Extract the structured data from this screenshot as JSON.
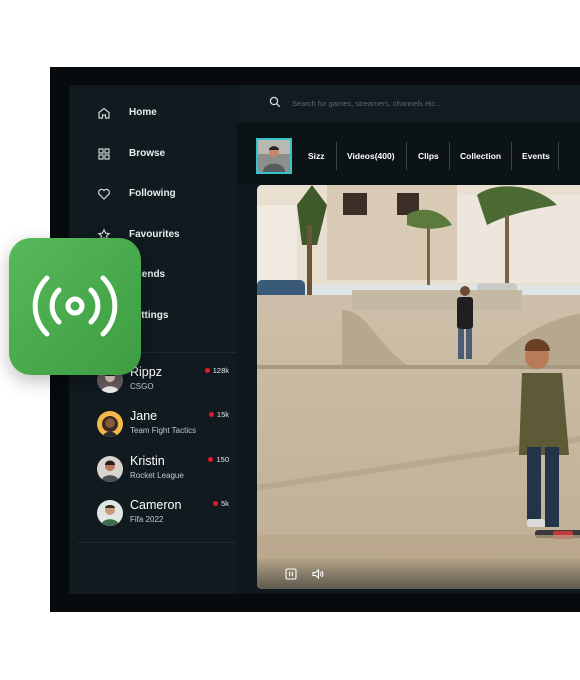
{
  "search": {
    "placeholder": "Search for games, streamers, channels etc..."
  },
  "nav": [
    {
      "label": "Home",
      "icon": "home-icon"
    },
    {
      "label": "Browse",
      "icon": "grid-icon"
    },
    {
      "label": "Following",
      "icon": "heart-icon"
    },
    {
      "label": "Favourites",
      "icon": "star-icon"
    },
    {
      "label": "Friends",
      "icon": "friends-icon"
    },
    {
      "label": "Settings",
      "icon": "gear-icon"
    }
  ],
  "streams": [
    {
      "name": "Rippz",
      "game": "CSGO",
      "views": "128k"
    },
    {
      "name": "Jane",
      "game": "Team Fight Tactics",
      "views": "15k"
    },
    {
      "name": "Kristin",
      "game": "Rocket League",
      "views": "150"
    },
    {
      "name": "Cameron",
      "game": "Fifa 2022",
      "views": "5k"
    }
  ],
  "tabs": [
    "Sizz",
    "Videos(400)",
    "Clips",
    "Collection",
    "Events"
  ],
  "colors": {
    "accent": "#35c2c9",
    "live_dot": "#e11d2a",
    "live_badge": "#4caf50",
    "background": "#0f181d"
  },
  "player": {
    "controls": [
      "pause-icon",
      "volume-icon"
    ]
  }
}
